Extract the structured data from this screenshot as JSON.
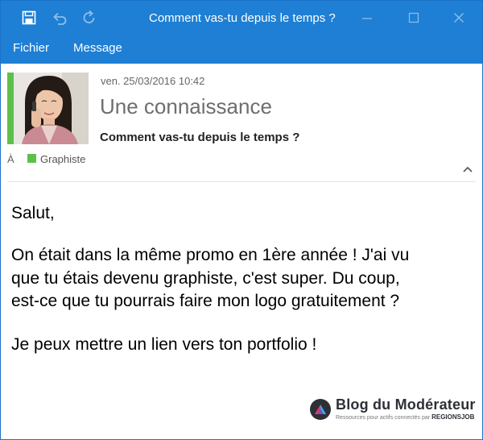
{
  "window": {
    "title": "Comment vas-tu depuis le temps ?",
    "accent_color": "#1e7fd4",
    "icons": [
      "save-icon",
      "undo-icon",
      "redo-icon",
      "minimize-icon",
      "maximize-icon",
      "close-icon"
    ]
  },
  "menu": {
    "items": [
      "Fichier",
      "Message"
    ]
  },
  "message": {
    "date": "ven. 25/03/2016  10:42",
    "sender": "Une connaissance",
    "subject": "Comment vas-tu depuis le temps ?",
    "to_label": "À",
    "category": "Graphiste",
    "category_color": "#5cc14a",
    "body": {
      "greeting": "Salut,",
      "paragraph1_line1": "On était dans la même promo en 1ère année ! J'ai vu",
      "paragraph1_line2": "que tu étais devenu graphiste, c'est super. Du coup,",
      "paragraph1_line3": "est-ce que tu pourrais faire mon logo gratuitement ?",
      "paragraph2": "Je peux mettre un lien vers ton portfolio !"
    }
  },
  "watermark": {
    "title": "Blog du Modérateur",
    "subtitle": "Ressources pour actifs connectés par",
    "brand": "REGIONSJOB"
  }
}
